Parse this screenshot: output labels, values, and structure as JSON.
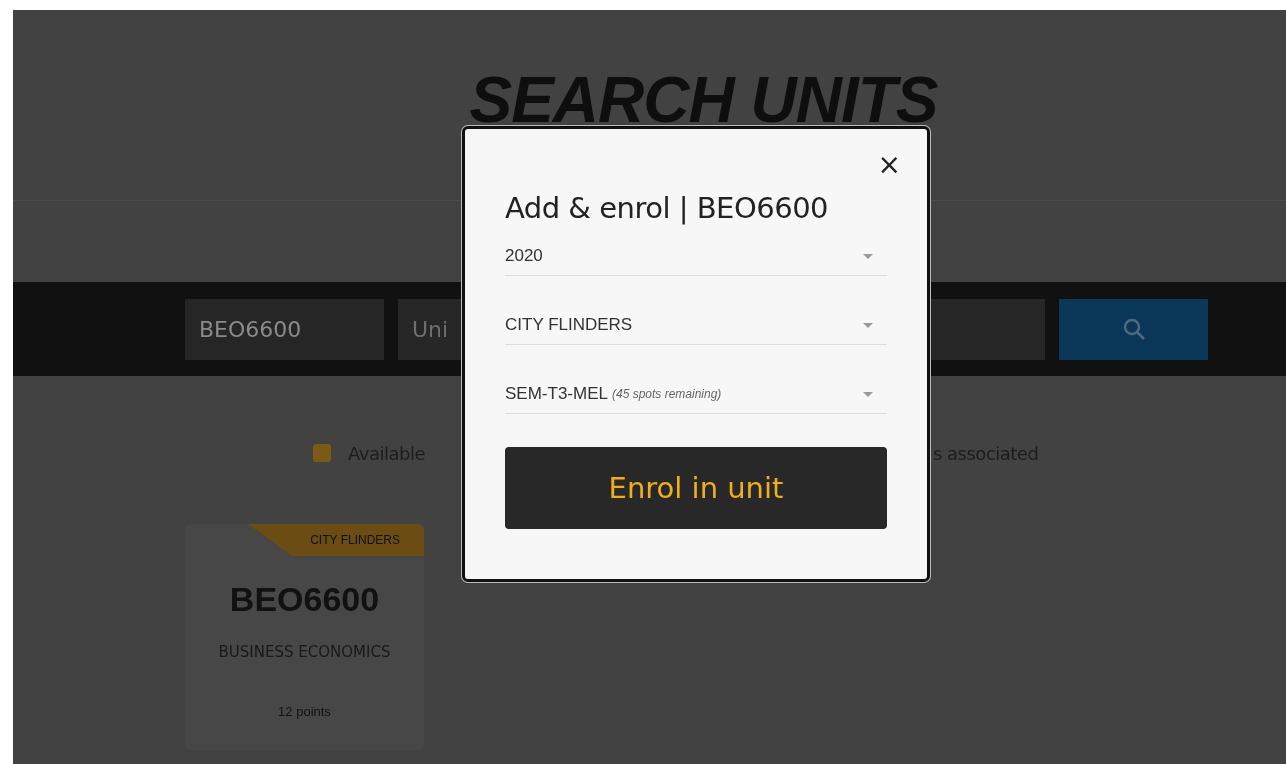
{
  "page": {
    "title": "SEARCH UNITS"
  },
  "search": {
    "unit_code": {
      "value": "BEO6600"
    },
    "unit_name": {
      "placeholder": "Uni"
    }
  },
  "legend": [
    {
      "label": "Available",
      "color": "#7a5a14"
    },
    {
      "label": "s associated"
    }
  ],
  "cards": [
    {
      "campus": "CITY FLINDERS",
      "code": "BEO6600",
      "name": "BUSINESS ECONOMICS",
      "points": "12 points"
    }
  ],
  "modal": {
    "title": "Add & enrol | BEO6600",
    "close": "×",
    "selects": [
      {
        "value": "2020"
      },
      {
        "value": "CITY FLINDERS"
      },
      {
        "value": "SEM-T3-MEL",
        "note": "(45 spots remaining)"
      }
    ],
    "button": "Enrol in unit"
  }
}
